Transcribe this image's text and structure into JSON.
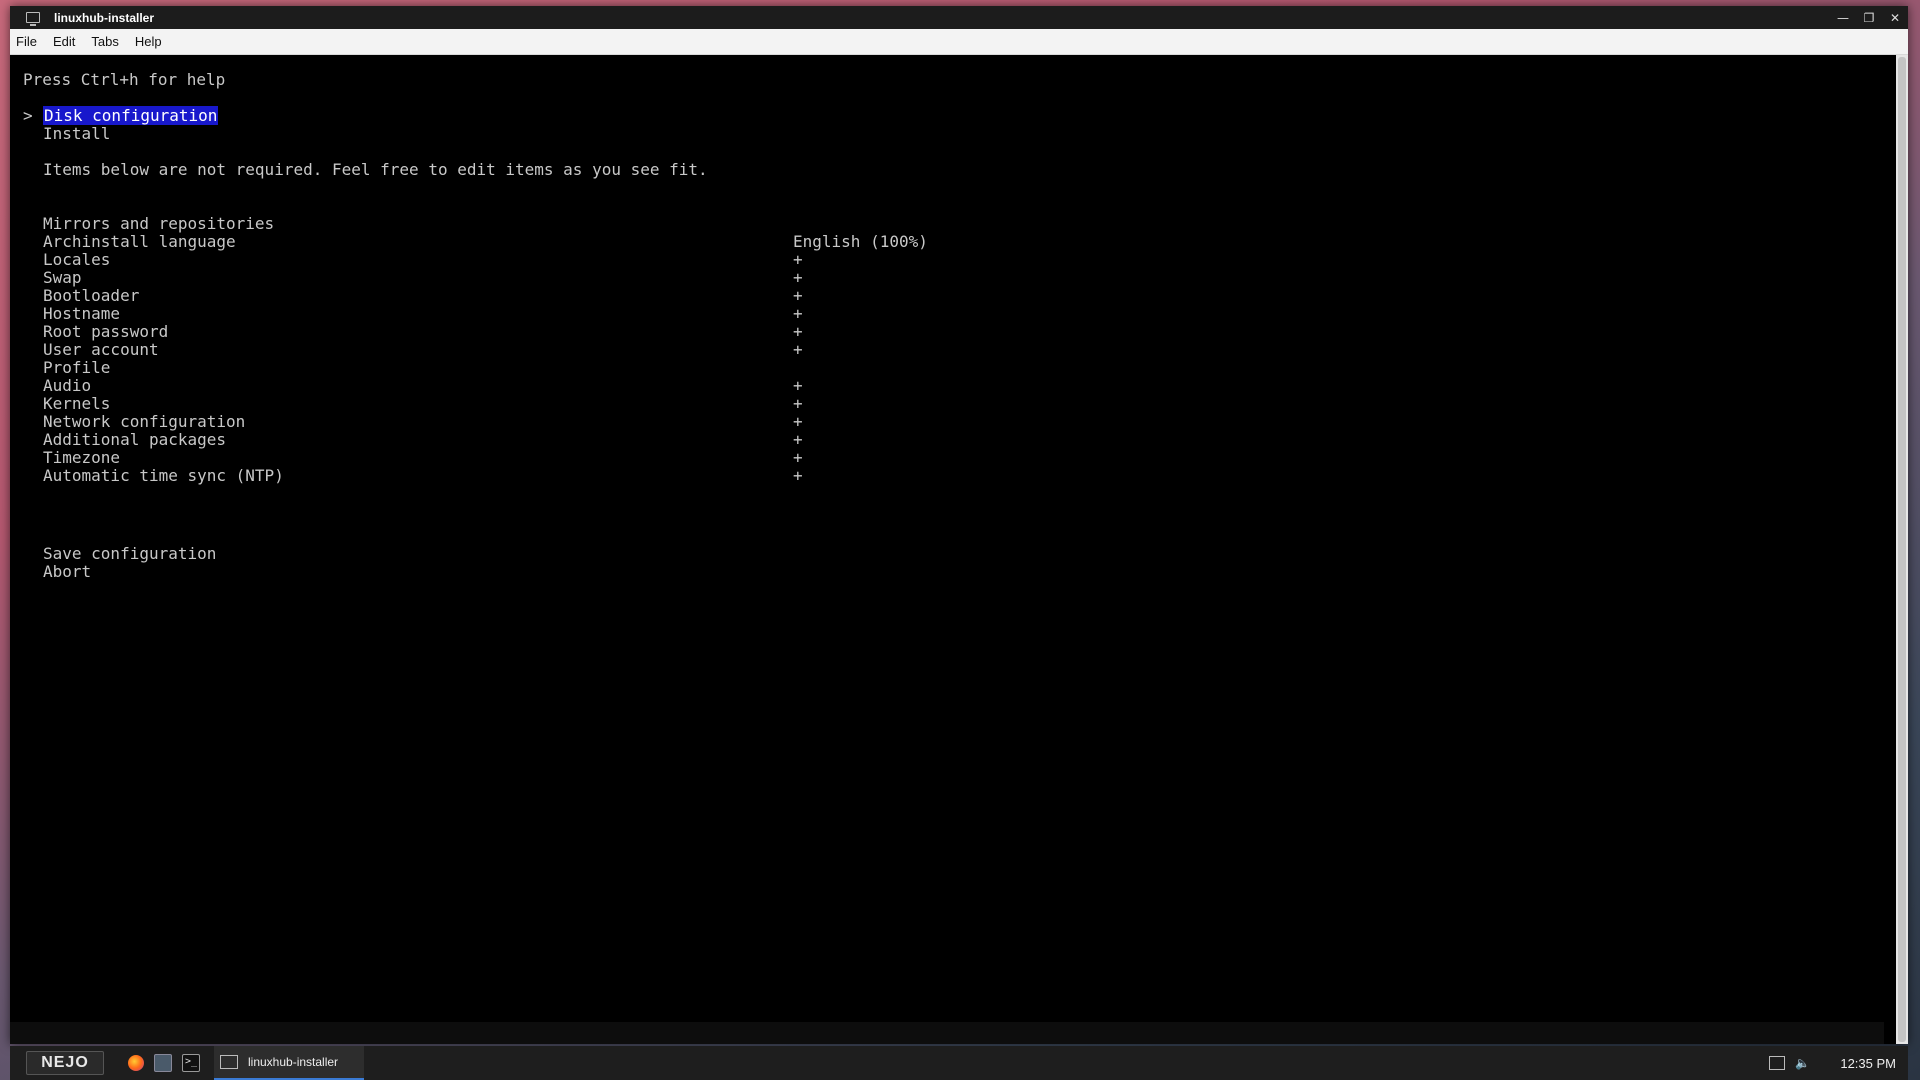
{
  "window": {
    "title": "linuxhub-installer",
    "controls": {
      "minimize": "—",
      "maximize": "❐",
      "close": "✕"
    }
  },
  "menubar": {
    "items": [
      "File",
      "Edit",
      "Tabs",
      "Help"
    ]
  },
  "terminal": {
    "help_line": "Press Ctrl+h for help",
    "cursor": ">",
    "primary_items": [
      "Disk configuration",
      "Install"
    ],
    "selected_index": 0,
    "note": "Items below are not required. Feel free to edit items as you see fit.",
    "optional_items": [
      {
        "label": "Mirrors and repositories",
        "value": ""
      },
      {
        "label": "Archinstall language",
        "value": "English (100%)"
      },
      {
        "label": "Locales",
        "value": "+"
      },
      {
        "label": "Swap",
        "value": "+"
      },
      {
        "label": "Bootloader",
        "value": "+"
      },
      {
        "label": "Hostname",
        "value": "+"
      },
      {
        "label": "Root password",
        "value": "+"
      },
      {
        "label": "User account",
        "value": "+"
      },
      {
        "label": "Profile",
        "value": ""
      },
      {
        "label": "Audio",
        "value": "+"
      },
      {
        "label": "Kernels",
        "value": "+"
      },
      {
        "label": "Network configuration",
        "value": "+"
      },
      {
        "label": "Additional packages",
        "value": "+"
      },
      {
        "label": "Timezone",
        "value": "+"
      },
      {
        "label": "Automatic time sync (NTP)",
        "value": "+"
      }
    ],
    "final_items": [
      "Save configuration",
      "Abort"
    ],
    "selection_color": "#1818cc"
  },
  "taskbar": {
    "start_label": "NEJO",
    "task_title": "linuxhub-installer",
    "clock": "12:35 PM"
  }
}
